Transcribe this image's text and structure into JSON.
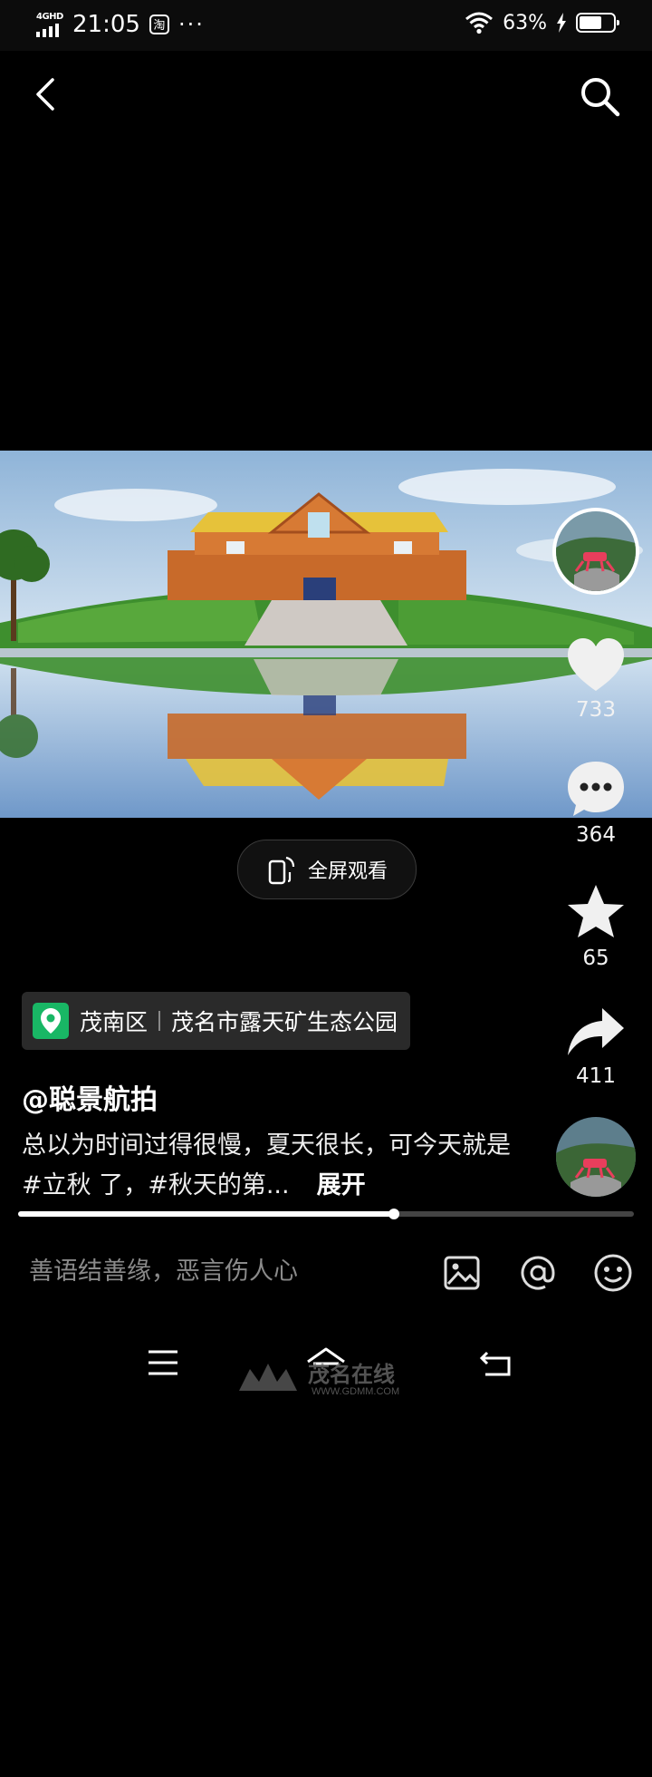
{
  "status_bar": {
    "network": "4GHD",
    "time": "21:05",
    "taobao": "淘",
    "more": "···",
    "battery": "63%"
  },
  "video": {
    "fullscreen_label": "全屏观看"
  },
  "actions": {
    "likes": "733",
    "comments": "364",
    "favorites": "65",
    "shares": "411"
  },
  "location": {
    "district": "茂南区",
    "place": "茂名市露天矿生态公园"
  },
  "post": {
    "author": "@聪景航拍",
    "description": "总以为时间过得很慢，夏天很长，可今天就是#立秋 了，#秋天的第...",
    "expand": "展开",
    "progress": 0.61
  },
  "comment": {
    "placeholder": "善语结善缘，恶言伤人心"
  },
  "watermark": {
    "brand": "茂名在线",
    "url": "WWW.GDMM.COM"
  },
  "colors": {
    "location_pin": "#19b765",
    "background": "#000000"
  }
}
